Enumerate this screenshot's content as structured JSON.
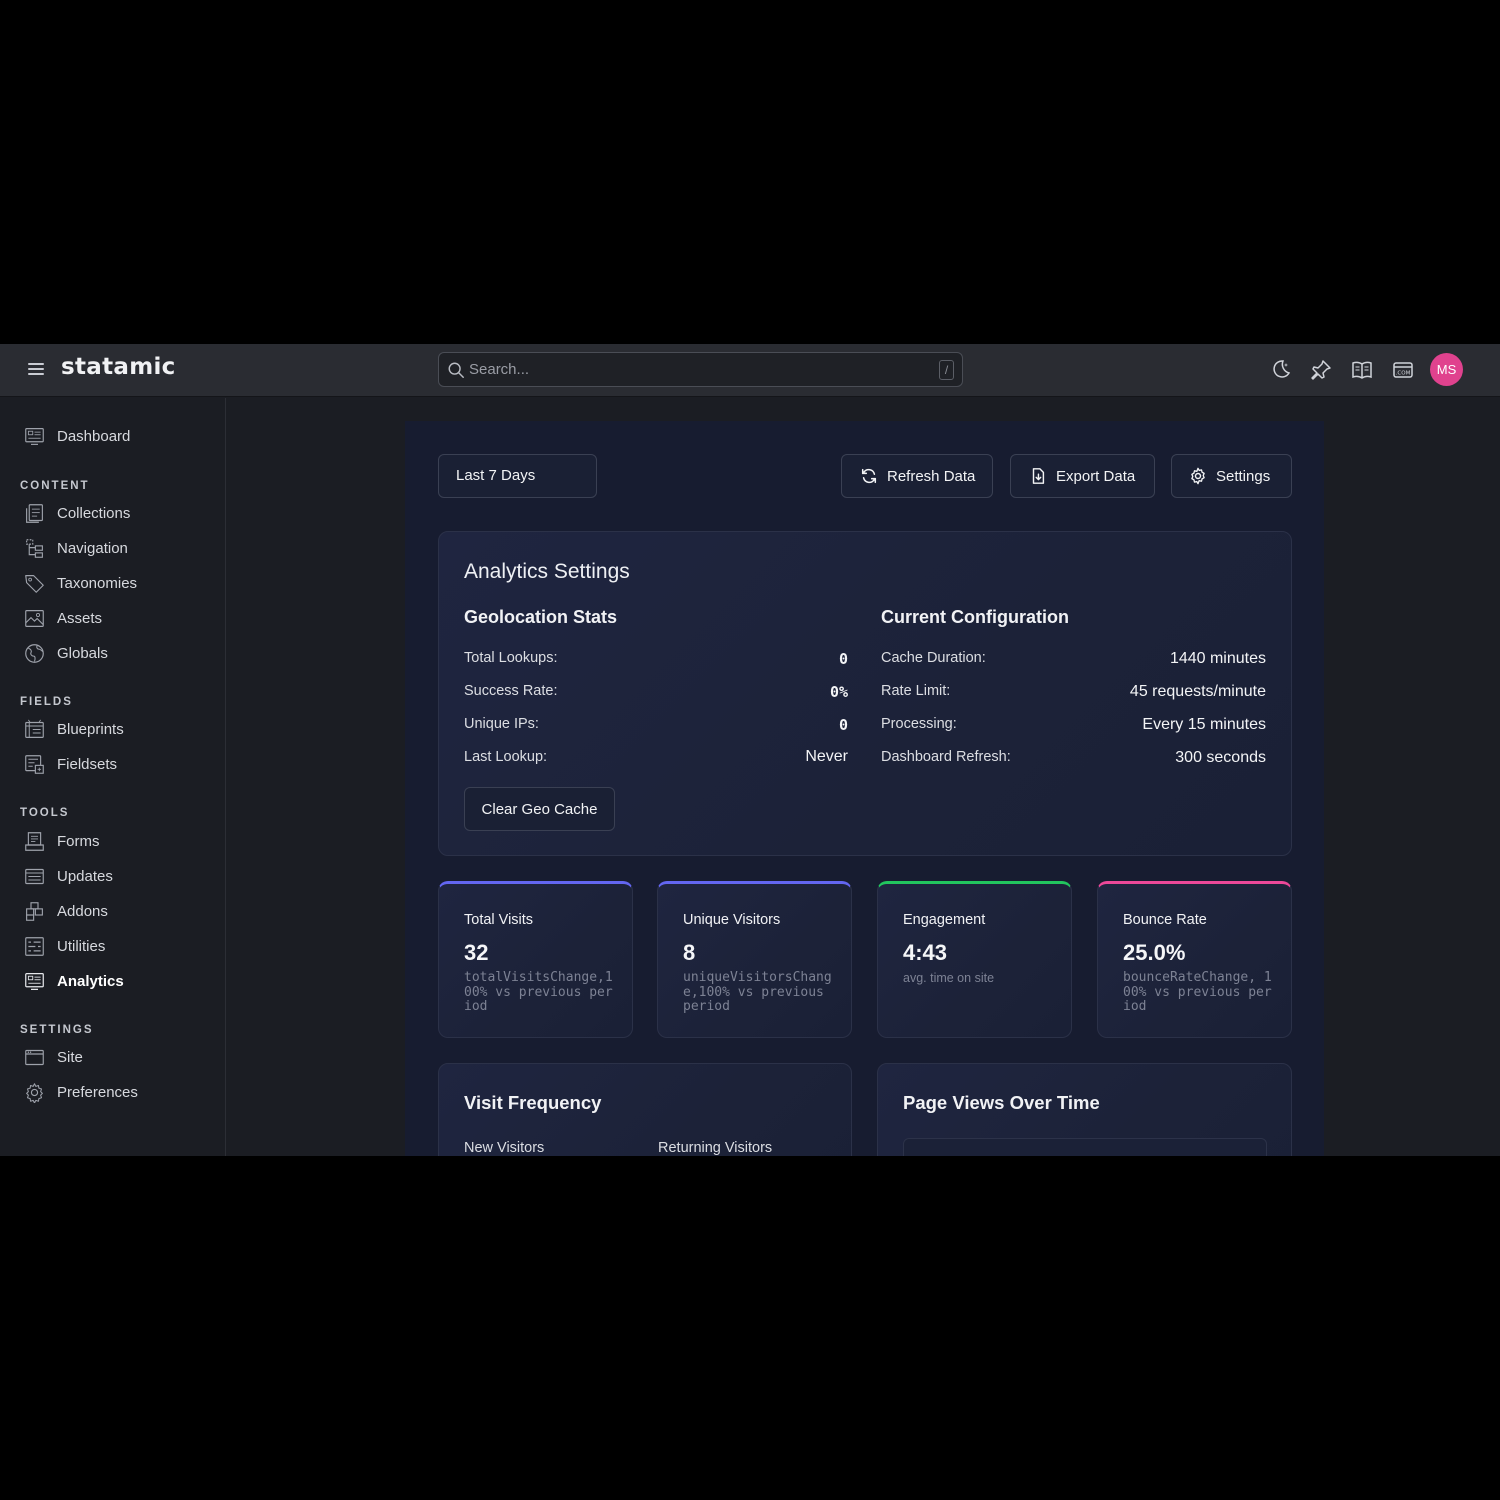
{
  "topbar": {
    "logo": "statamic",
    "search_placeholder": "Search...",
    "search_shortcut": "/",
    "icons": [
      "moon-icon",
      "pin-icon",
      "book-icon",
      "domain-icon"
    ],
    "avatar_initials": "MS",
    "avatar_color": "#e0428e"
  },
  "sidebar": {
    "dashboard": "Dashboard",
    "sections": {
      "content": "CONTENT",
      "fields": "FIELDS",
      "tools": "TOOLS",
      "settings": "SETTINGS"
    },
    "content_items": [
      "Collections",
      "Navigation",
      "Taxonomies",
      "Assets",
      "Globals"
    ],
    "fields_items": [
      "Blueprints",
      "Fieldsets"
    ],
    "tools_items": [
      "Forms",
      "Updates",
      "Addons",
      "Utilities",
      "Analytics"
    ],
    "settings_items": [
      "Site",
      "Preferences"
    ],
    "active": "Analytics"
  },
  "toolbar": {
    "range": "Last 7 Days",
    "refresh": "Refresh Data",
    "export": "Export Data",
    "settings": "Settings"
  },
  "analytics_settings": {
    "title": "Analytics Settings",
    "geo": {
      "title": "Geolocation Stats",
      "rows": [
        {
          "label": "Total Lookups:",
          "value": "0"
        },
        {
          "label": "Success Rate:",
          "value": "0%"
        },
        {
          "label": "Unique IPs:",
          "value": "0"
        },
        {
          "label": "Last Lookup:",
          "value": "Never"
        }
      ],
      "clear_button": "Clear Geo Cache"
    },
    "config": {
      "title": "Current Configuration",
      "rows": [
        {
          "label": "Cache Duration:",
          "value": "1440 minutes"
        },
        {
          "label": "Rate Limit:",
          "value": "45 requests/minute"
        },
        {
          "label": "Processing:",
          "value": "Every 15 minutes"
        },
        {
          "label": "Dashboard Refresh:",
          "value": "300 seconds"
        }
      ]
    }
  },
  "stats": [
    {
      "title": "Total Visits",
      "value": "32",
      "change": "totalVisitsChange,100% vs previous period",
      "accent": "#6366f1"
    },
    {
      "title": "Unique Visitors",
      "value": "8",
      "change": "uniqueVisitorsChange,100% vs previous period",
      "accent": "#6366f1"
    },
    {
      "title": "Engagement",
      "value": "4:43",
      "change": "avg. time on site",
      "accent": "#22c55e"
    },
    {
      "title": "Bounce Rate",
      "value": "25.0%",
      "change": "bounceRateChange, 100% vs previous period",
      "accent": "#ec4899"
    }
  ],
  "visit_frequency": {
    "title": "Visit Frequency",
    "new": "New Visitors",
    "returning": "Returning Visitors"
  },
  "page_views": {
    "title": "Page Views Over Time"
  }
}
